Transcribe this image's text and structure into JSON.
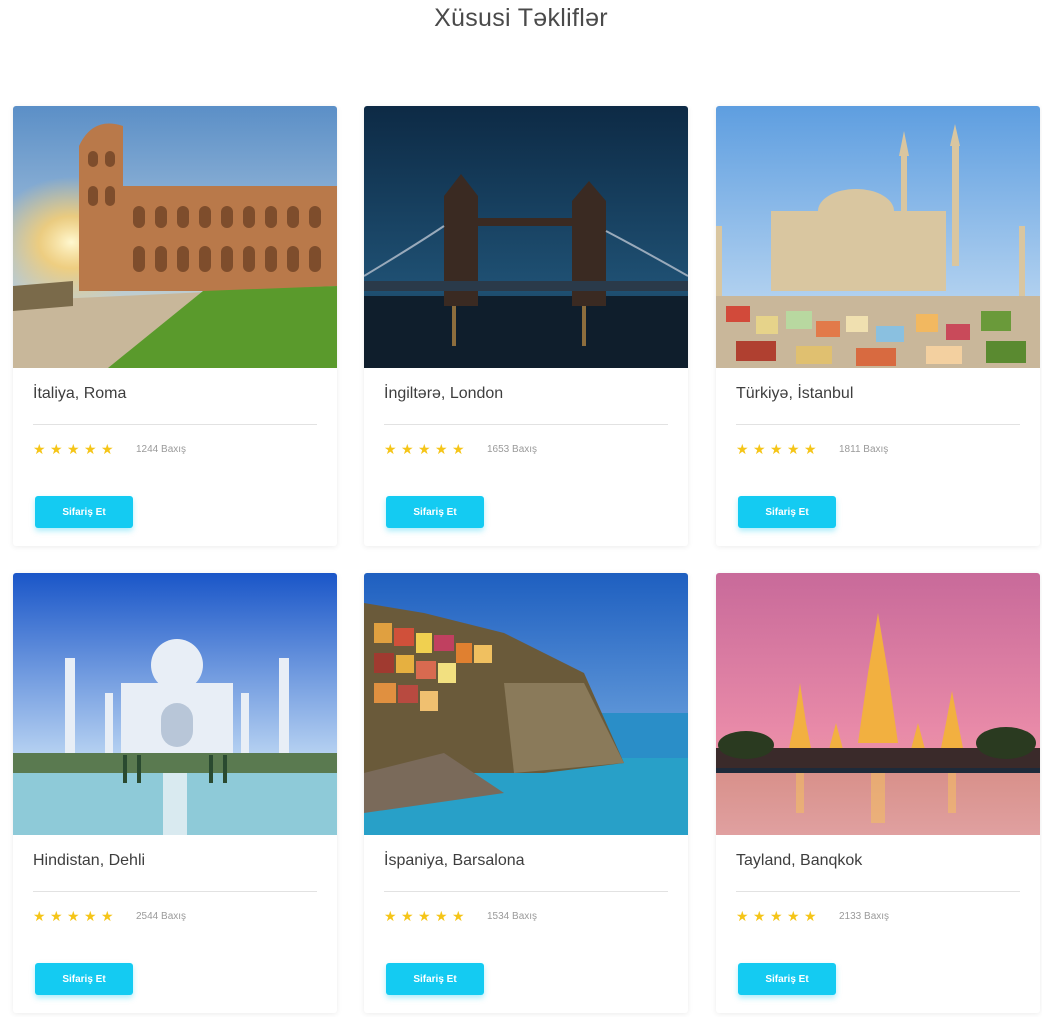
{
  "section": {
    "title": "Xüsusi Təkliflər"
  },
  "accent_color": "#14cbf2",
  "star_color": "#f5c518",
  "cards": [
    {
      "name": "İtaliya, Roma",
      "rating": 5,
      "reviews": "1244 Baxış",
      "button": "Sifariş Et",
      "image": "colosseum"
    },
    {
      "name": "İngiltərə, London",
      "rating": 5,
      "reviews": "1653 Baxış",
      "button": "Sifariş Et",
      "image": "tower-bridge"
    },
    {
      "name": "Türkiyə, İstanbul",
      "rating": 5,
      "reviews": "1811 Baxış",
      "button": "Sifariş Et",
      "image": "mosque"
    },
    {
      "name": "Hindistan, Dehli",
      "rating": 5,
      "reviews": "2544 Baxış",
      "button": "Sifariş Et",
      "image": "taj-mahal"
    },
    {
      "name": "İspaniya, Barsalona",
      "rating": 5,
      "reviews": "1534 Baxış",
      "button": "Sifariş Et",
      "image": "coastal-village"
    },
    {
      "name": "Tayland, Banqkok",
      "rating": 5,
      "reviews": "2133 Baxış",
      "button": "Sifariş Et",
      "image": "temple"
    }
  ]
}
